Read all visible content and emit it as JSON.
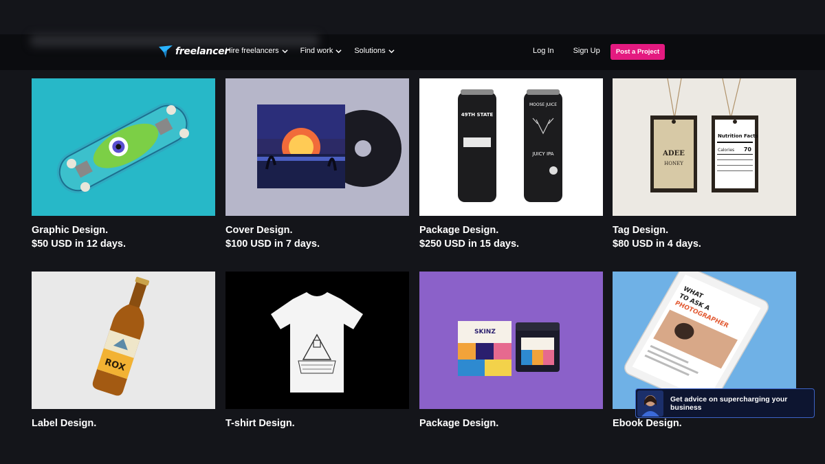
{
  "brand": {
    "name": "freelancer"
  },
  "nav": {
    "items": [
      {
        "label": "Hire freelancers"
      },
      {
        "label": "Find work"
      },
      {
        "label": "Solutions"
      }
    ],
    "login": "Log In",
    "signup": "Sign Up",
    "post_project": "Post a Project"
  },
  "cards": [
    {
      "title": "Graphic Design.",
      "price": "$50 USD in 12 days.",
      "image": "skateboard"
    },
    {
      "title": "Cover Design.",
      "price": "$100 USD in 7 days.",
      "image": "album-cover"
    },
    {
      "title": "Package Design.",
      "price": "$250 USD in 15 days.",
      "image": "beer-cans"
    },
    {
      "title": "Tag Design.",
      "price": "$80 USD in 4 days.",
      "image": "hang-tags"
    },
    {
      "title": "Label Design.",
      "image": "beer-bottle"
    },
    {
      "title": "T-shirt Design.",
      "image": "t-shirt"
    },
    {
      "title": "Package Design.",
      "image": "skinz-box"
    },
    {
      "title": "Ebook Design.",
      "image": "tablet-ebook"
    }
  ],
  "image_text": {
    "can1": "49TH STATE",
    "can2": "MOOSE JUICE",
    "can2_sub": "JUICY IPA",
    "tag_facts": "Nutrition Facts",
    "tag_calories": "Calories",
    "tag_calories_value": "70",
    "tag_brand": "ADEE",
    "tag_brand_sub": "HONEY",
    "bottle_label": "ROX",
    "box_brand": "SKINZ",
    "ebook_title_1": "WHAT",
    "ebook_title_2": "TO ASK A",
    "ebook_title_3": "PHOTOGRAPHER"
  },
  "advice": {
    "text": "Get advice on supercharging your business"
  },
  "colors": {
    "accent": "#e41a80",
    "background": "#14151a",
    "navbar": "#0b0c0f",
    "brand_blue": "#29b2fe"
  }
}
